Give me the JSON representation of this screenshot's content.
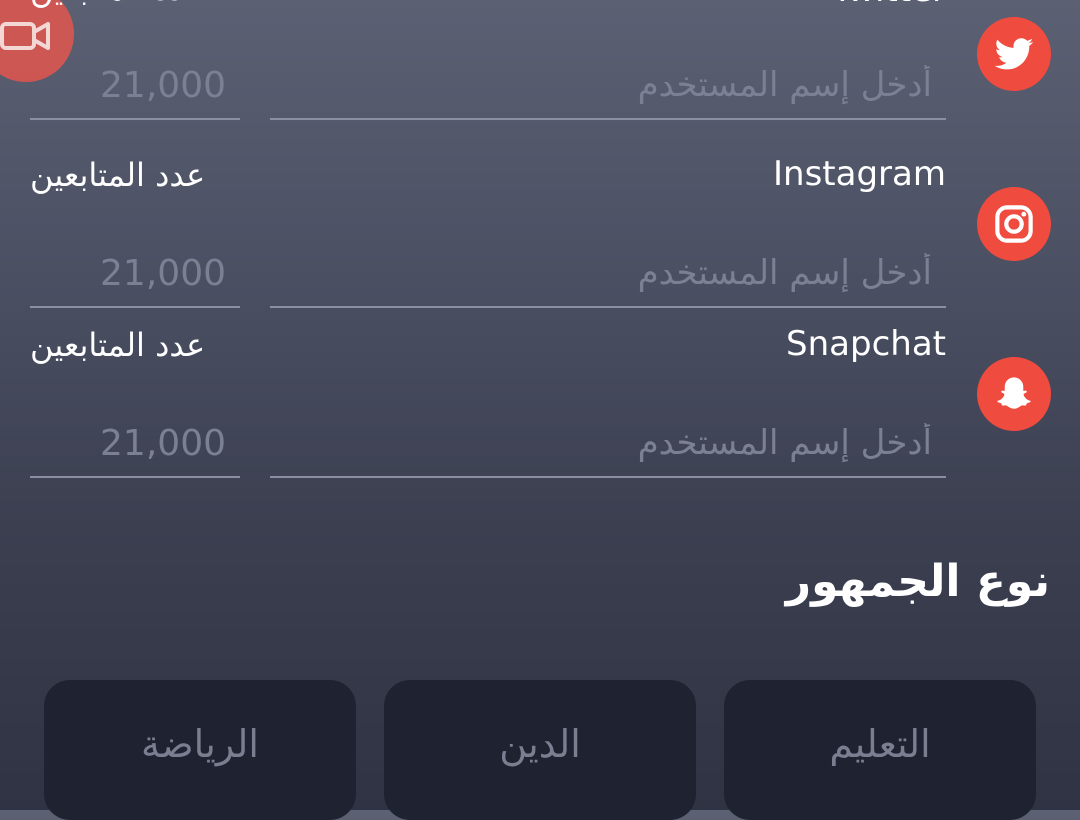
{
  "recording_indicator": {
    "icon": "video-camera-icon"
  },
  "social_rows": [
    {
      "platform": "Twitter",
      "icon": "twitter-icon",
      "followers_label": "عدد المتابعين",
      "username_placeholder": "أدخل إسم المستخدم",
      "followers_placeholder": "21,000"
    },
    {
      "platform": "Instagram",
      "icon": "instagram-icon",
      "followers_label": "عدد المتابعين",
      "username_placeholder": "أدخل إسم المستخدم",
      "followers_placeholder": "21,000"
    },
    {
      "platform": "Snapchat",
      "icon": "snapchat-icon",
      "followers_label": "عدد المتابعين",
      "username_placeholder": "أدخل إسم المستخدم",
      "followers_placeholder": "21,000"
    }
  ],
  "audience": {
    "title": "نوع الجمهور",
    "options": [
      "التعليم",
      "الدين",
      "الرياضة"
    ]
  },
  "colors": {
    "accent": "#f04b3f",
    "chip_bg": "#1f2230",
    "placeholder": "#7b8093"
  }
}
